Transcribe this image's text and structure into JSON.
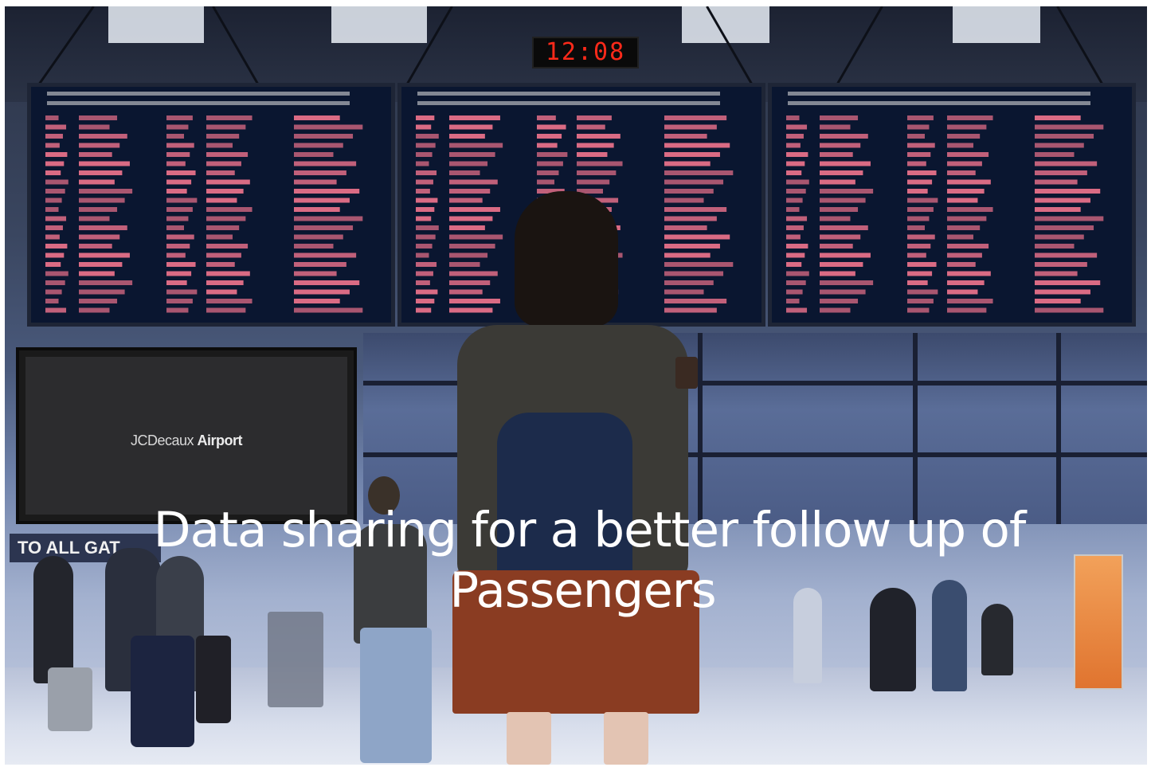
{
  "clock": {
    "time": "12:08"
  },
  "screen": {
    "brand": "JCDecaux",
    "suffix": "Airport"
  },
  "sign": {
    "text": "TO ALL GAT"
  },
  "overlay": {
    "line1": "Data sharing for a better follow up of",
    "line2": "Passengers"
  },
  "colors": {
    "board_bg": "#0a1630",
    "board_text": "#ff7a93",
    "overlay_text": "#ffffff",
    "clock_digits": "#ff2a1a"
  }
}
